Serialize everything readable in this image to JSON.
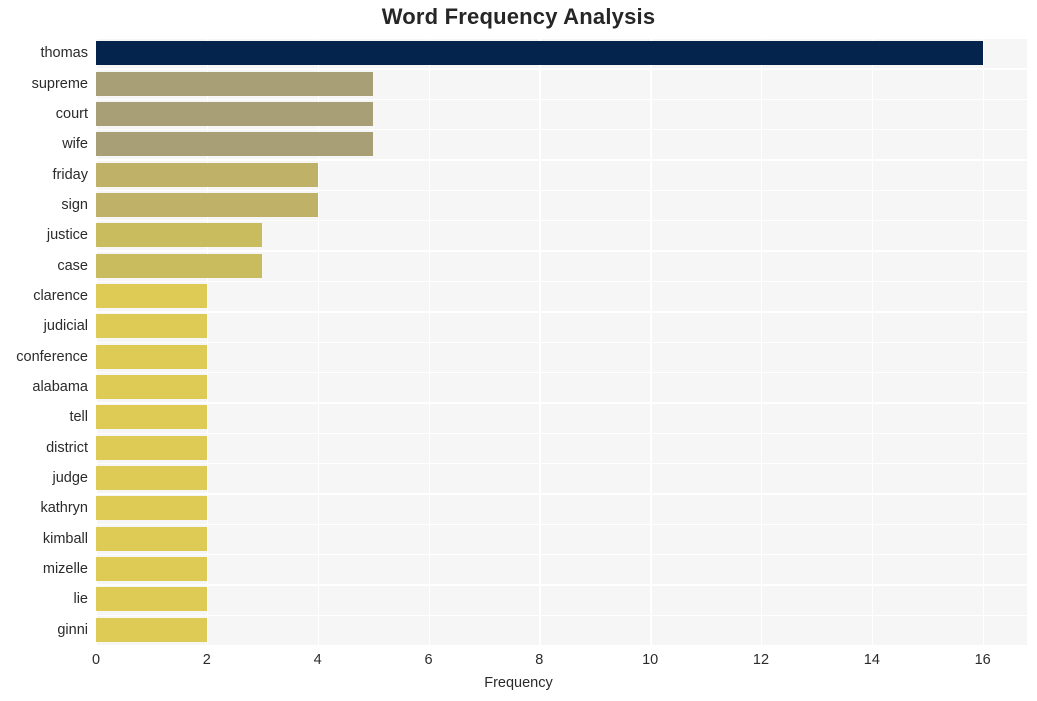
{
  "chart_data": {
    "type": "bar",
    "orientation": "horizontal",
    "title": "Word Frequency Analysis",
    "xlabel": "Frequency",
    "ylabel": "",
    "xlim": [
      0,
      16.8
    ],
    "xticks": [
      0,
      2,
      4,
      6,
      8,
      10,
      12,
      14,
      16
    ],
    "grid": true,
    "legend": "none",
    "categories": [
      "thomas",
      "supreme",
      "court",
      "wife",
      "friday",
      "sign",
      "justice",
      "case",
      "clarence",
      "judicial",
      "conference",
      "alabama",
      "tell",
      "district",
      "judge",
      "kathryn",
      "kimball",
      "mizelle",
      "lie",
      "ginni"
    ],
    "values": [
      16,
      5,
      5,
      5,
      4,
      4,
      3,
      3,
      2,
      2,
      2,
      2,
      2,
      2,
      2,
      2,
      2,
      2,
      2,
      2
    ],
    "bar_colors": [
      "#04234d",
      "#a89f77",
      "#a89f77",
      "#a89f77",
      "#bfb168",
      "#bfb168",
      "#c9bc5f",
      "#c9bc5f",
      "#ddcb55",
      "#ddcb55",
      "#ddcb55",
      "#ddcb55",
      "#ddcb55",
      "#ddcb55",
      "#ddcb55",
      "#ddcb55",
      "#ddcb55",
      "#ddcb55",
      "#ddcb55",
      "#ddcb55"
    ]
  },
  "style": {
    "plot_background": "#f6f6f7",
    "gridline_color": "#ffffff",
    "figure_background": "#ffffff",
    "text_color": "#2b2b2b",
    "title_color": "#262626"
  }
}
